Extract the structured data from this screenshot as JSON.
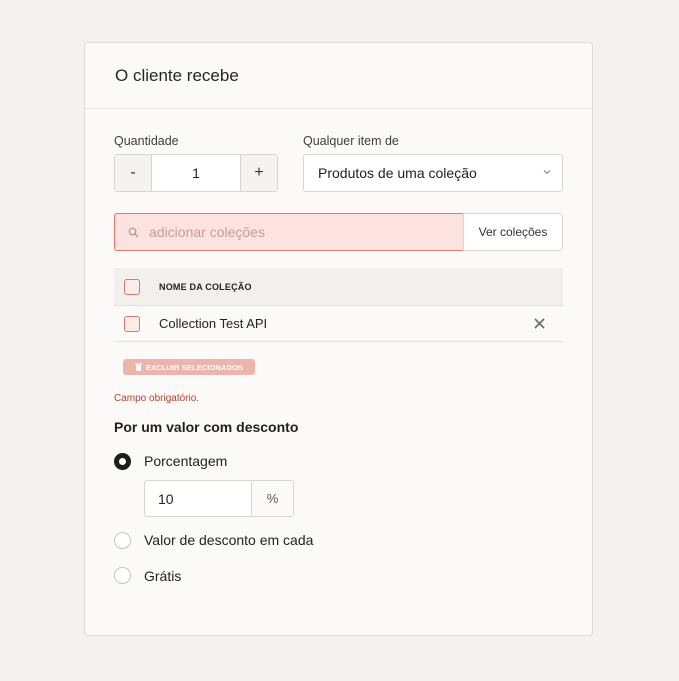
{
  "card": {
    "title": "O cliente recebe"
  },
  "quantity": {
    "label": "Quantidade",
    "minus": "-",
    "value": "1",
    "plus": "+"
  },
  "any_item": {
    "label": "Qualquer item de",
    "selected": "Produtos de uma coleção"
  },
  "search": {
    "placeholder": "adicionar coleções",
    "icon": "search-icon",
    "browse_label": "Ver coleções"
  },
  "table": {
    "header": "NOME DA COLEÇÃO",
    "rows": [
      {
        "name": "Collection Test API"
      }
    ]
  },
  "delete_selected": {
    "label": "EXCLUIR SELECIONADOS",
    "icon": "trash-icon"
  },
  "error": "Campo obrigatório.",
  "discount": {
    "title": "Por um valor com desconto",
    "options": [
      {
        "label": "Porcentagem",
        "selected": true
      },
      {
        "label": "Valor de desconto em cada",
        "selected": false
      },
      {
        "label": "Grátis",
        "selected": false
      }
    ],
    "percentage": {
      "value": "10",
      "unit": "%"
    }
  },
  "colors": {
    "accent": "#e7796a",
    "error": "#b4402f",
    "danger_fill": "#fde3df"
  }
}
